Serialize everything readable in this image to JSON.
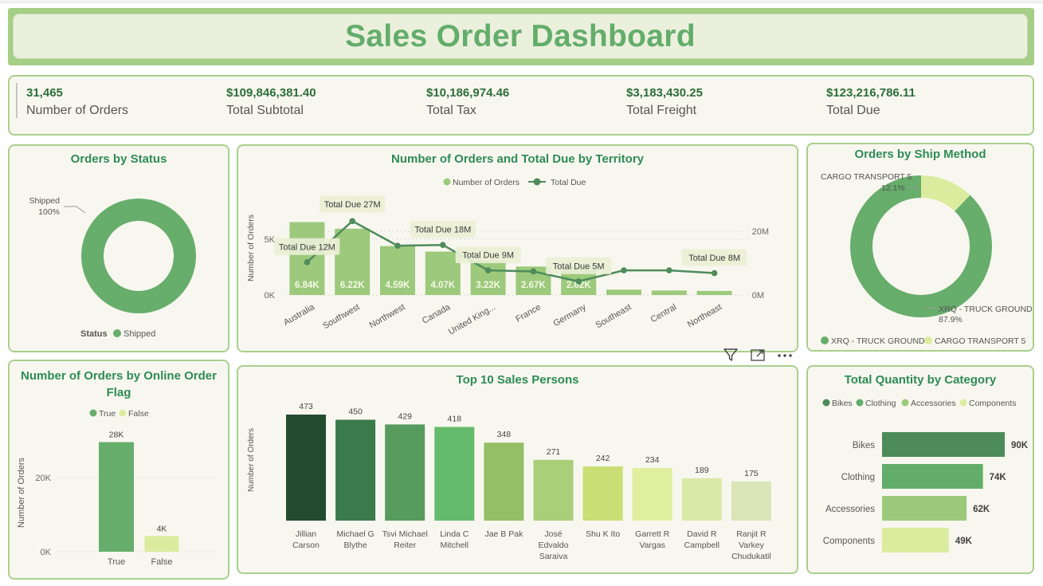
{
  "dashboard": {
    "title": "Sales Order Dashboard"
  },
  "kpis": [
    {
      "value": "31,465",
      "label": "Number of Orders"
    },
    {
      "value": "$109,846,381.40",
      "label": "Total Subtotal"
    },
    {
      "value": "$10,186,974.46",
      "label": "Total Tax"
    },
    {
      "value": "$3,183,430.25",
      "label": "Total Freight"
    },
    {
      "value": "$123,216,786.11",
      "label": "Total Due"
    }
  ],
  "status_panel": {
    "title": "Orders by Status",
    "slice_label": "Shipped",
    "slice_pct": "100%",
    "legend_title": "Status",
    "legend_item": "Shipped",
    "color": "#67ad6c"
  },
  "territory_panel": {
    "title": "Number of Orders and Total Due by Territory",
    "legend": [
      "Number of Orders",
      "Total Due"
    ],
    "y_left_label": "Number of Orders",
    "y_left_ticks": [
      "5K",
      "0K"
    ],
    "y_right_ticks": [
      "20M",
      "0M"
    ],
    "bar_color": "#9cc97b",
    "line_color": "#4f8b5c"
  },
  "shipmethod_panel": {
    "title": "Orders by Ship Method",
    "slices": [
      {
        "name": "XRQ - TRUCK GROUND",
        "pct": "87.9%",
        "color": "#67ad6c"
      },
      {
        "name": "CARGO TRANSPORT 5",
        "pct": "12.1%",
        "color": "#dcec9f"
      }
    ]
  },
  "online_panel": {
    "title_line1": "Number of Orders by Online Order",
    "title_line2": "Flag",
    "legend": [
      "True",
      "False"
    ],
    "y_label": "Number of Orders",
    "y_ticks": [
      "20K",
      "0K"
    ],
    "colors": [
      "#67ad6c",
      "#dcec9f"
    ]
  },
  "salespersons_panel": {
    "title": "Top 10 Sales Persons",
    "y_label": "Number of Orders"
  },
  "category_panel": {
    "title": "Total Quantity by Category",
    "legend": [
      "Bikes",
      "Clothing",
      "Accessories",
      "Components"
    ],
    "legend_colors": [
      "#4d8b5a",
      "#63ad6b",
      "#9cc97b",
      "#dcec9f"
    ]
  },
  "visual_header_icons": [
    "filter-icon",
    "focus-mode-icon",
    "more-options-icon"
  ],
  "chart_data": [
    {
      "type": "pie",
      "title": "Orders by Status",
      "categories": [
        "Shipped"
      ],
      "values": [
        100
      ]
    },
    {
      "type": "bar",
      "title": "Number of Orders and Total Due by Territory",
      "categories": [
        "Australia",
        "Southwest",
        "Northwest",
        "Canada",
        "United King...",
        "France",
        "Germany",
        "Southeast",
        "Central",
        "Northeast"
      ],
      "series": [
        {
          "name": "Number of Orders",
          "type": "bar",
          "values": [
            6840,
            6220,
            4590,
            4070,
            3220,
            2670,
            2620,
            500,
            420,
            380
          ],
          "labels": [
            "6.84K",
            "6.22K",
            "4.59K",
            "4.07K",
            "3.22K",
            "2.67K",
            "2.62K",
            "",
            "",
            ""
          ]
        },
        {
          "name": "Total Due",
          "type": "line",
          "values": [
            12,
            27,
            18,
            18.3,
            9,
            8.6,
            5,
            9,
            9,
            8
          ],
          "labels": [
            "Total Due 12M",
            "Total Due 27M",
            "",
            "Total Due 18M",
            "Total Due 9M",
            "",
            "Total Due 5M",
            "",
            "",
            "Total Due 8M"
          ]
        }
      ],
      "ylabel": "Number of Orders",
      "ylim": [
        0,
        9500
      ],
      "y2lim": [
        0,
        37
      ]
    },
    {
      "type": "pie",
      "title": "Orders by Ship Method",
      "categories": [
        "XRQ - TRUCK GROUND",
        "CARGO TRANSPORT 5"
      ],
      "values": [
        87.9,
        12.1
      ]
    },
    {
      "type": "bar",
      "title": "Number of Orders by Online Order Flag",
      "categories": [
        "True",
        "False"
      ],
      "values": [
        28000,
        4000
      ],
      "labels": [
        "28K",
        "4K"
      ],
      "ylabel": "Number of Orders",
      "ylim": [
        0,
        33000
      ]
    },
    {
      "type": "bar",
      "title": "Top 10 Sales Persons",
      "categories": [
        [
          "Jillian",
          "Carson"
        ],
        [
          "Michael G",
          "Blythe"
        ],
        [
          "Tsvi Michael",
          "Reiter"
        ],
        [
          "Linda C",
          "Mitchell"
        ],
        [
          "Jae B Pak"
        ],
        [
          "José",
          "Edvaldo",
          "Saraiva"
        ],
        [
          "Shu K Ito"
        ],
        [
          "Garrett R",
          "Vargas"
        ],
        [
          "David R",
          "Campbell"
        ],
        [
          "Ranjit R",
          "Varkey",
          "Chudukatil"
        ]
      ],
      "values": [
        473,
        450,
        429,
        418,
        348,
        271,
        242,
        234,
        189,
        175
      ],
      "colors": [
        "#234b2f",
        "#3b7a4b",
        "#579b5f",
        "#64bb6b",
        "#95bf67",
        "#a9cf7b",
        "#c9df75",
        "#dfef9d",
        "#d9e9a8",
        "#dae5b8"
      ],
      "ylabel": "Number of Orders"
    },
    {
      "type": "bar",
      "orientation": "horizontal",
      "title": "Total Quantity by Category",
      "categories": [
        "Bikes",
        "Clothing",
        "Accessories",
        "Components"
      ],
      "values": [
        90000,
        74000,
        62000,
        49000
      ],
      "labels": [
        "90K",
        "74K",
        "62K",
        "49K"
      ],
      "colors": [
        "#4d8b5a",
        "#63ad6b",
        "#9cc97b",
        "#dcec9f"
      ]
    }
  ]
}
